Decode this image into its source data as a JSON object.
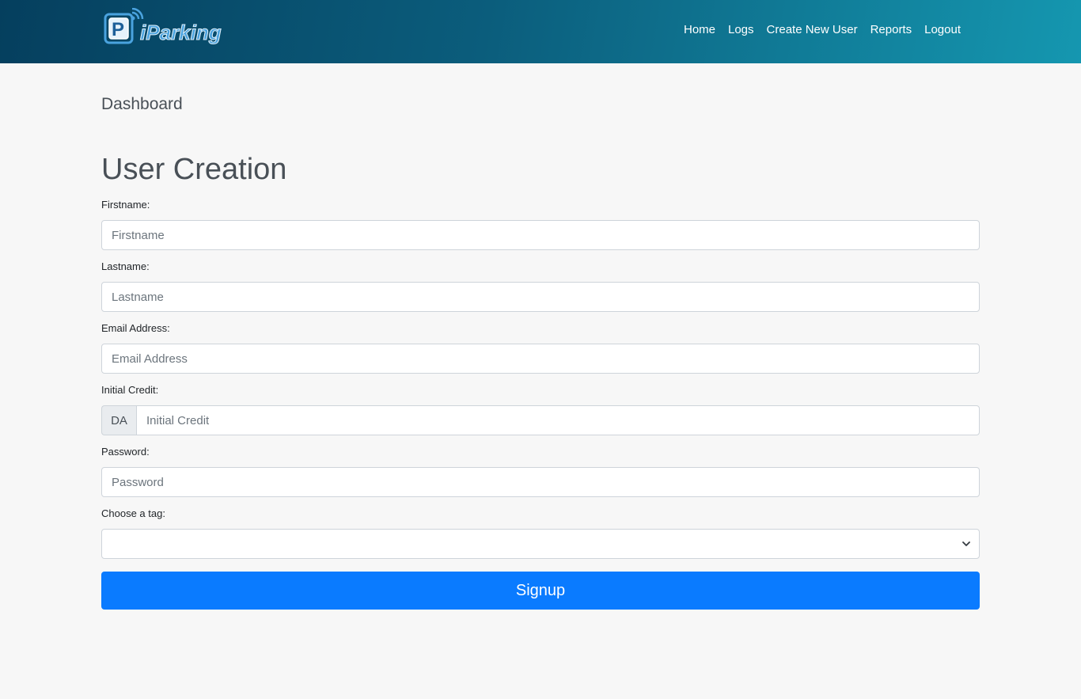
{
  "brand": {
    "name": "iParking",
    "icon": "parking-logo-icon"
  },
  "nav": {
    "items": [
      {
        "label": "Home"
      },
      {
        "label": "Logs"
      },
      {
        "label": "Create New User"
      },
      {
        "label": "Reports"
      },
      {
        "label": "Logout"
      }
    ]
  },
  "main": {
    "breadcrumb": "Dashboard",
    "title": "User Creation"
  },
  "form": {
    "firstname": {
      "label": "Firstname:",
      "placeholder": "Firstname",
      "value": ""
    },
    "lastname": {
      "label": "Lastname:",
      "placeholder": "Lastname",
      "value": ""
    },
    "email": {
      "label": "Email Address:",
      "placeholder": "Email Address",
      "value": ""
    },
    "credit": {
      "label": "Initial Credit:",
      "prefix": "DA",
      "placeholder": "Initial Credit",
      "value": ""
    },
    "password": {
      "label": "Password:",
      "placeholder": "Password",
      "value": ""
    },
    "tag": {
      "label": "Choose a tag:",
      "selected": ""
    },
    "submit_label": "Signup"
  },
  "colors": {
    "navbar_start": "#053f5e",
    "navbar_end": "#1597b0",
    "primary_button": "#0a7bff",
    "page_background": "#f7f7f7"
  }
}
